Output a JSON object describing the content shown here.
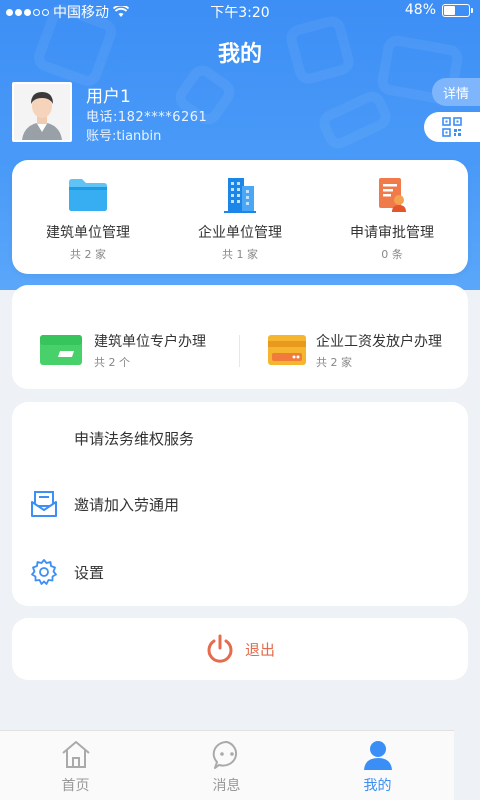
{
  "status_bar": {
    "carrier": "中国移动",
    "time": "下午3:20",
    "battery": "48%",
    "battery_level": 48
  },
  "header": {
    "title": "我的"
  },
  "user": {
    "name": "用户1",
    "phone": "电话:182****6261",
    "account": "账号:tianbin",
    "detail_label": "详情"
  },
  "management": [
    {
      "label": "建筑单位管理",
      "count": "共 2 家"
    },
    {
      "label": "企业单位管理",
      "count": "共 1 家"
    },
    {
      "label": "申请审批管理",
      "count": "0 条"
    }
  ],
  "accounts": [
    {
      "label": "建筑单位专户办理",
      "count": "共 2 个"
    },
    {
      "label": "企业工资发放户办理",
      "count": "共 2 家"
    }
  ],
  "menu": [
    {
      "label": "申请法务维权服务"
    },
    {
      "label": "邀请加入劳通用"
    },
    {
      "label": "设置"
    }
  ],
  "logout_label": "退出",
  "tabs": [
    {
      "label": "首页"
    },
    {
      "label": "消息"
    },
    {
      "label": "我的"
    }
  ],
  "colors": {
    "primary": "#3d8ef5",
    "logout": "#e46b4c",
    "tab_active": "#3a8ef5"
  }
}
